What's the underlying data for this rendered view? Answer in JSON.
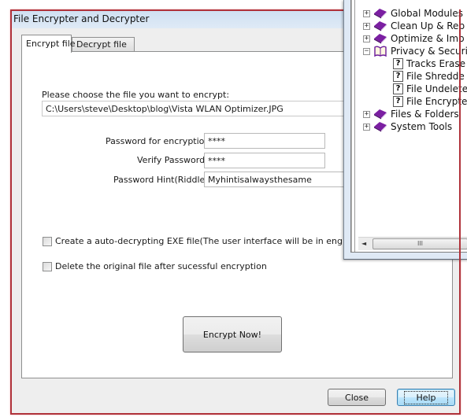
{
  "window": {
    "title": "File Encrypter and Decrypter"
  },
  "tabs": [
    {
      "label": "Encrypt file",
      "active": true
    },
    {
      "label": "Decrypt file",
      "active": false
    }
  ],
  "encrypt": {
    "choose_label": "Please choose the file you want to encrypt:",
    "file_path": "C:\\Users\\steve\\Desktop\\blog\\Vista WLAN Optimizer.JPG",
    "password_label": "Password for encryption:",
    "password_value": "****",
    "verify_label": "Verify Password:",
    "verify_value": "****",
    "hint_label": "Password Hint(Riddle):",
    "hint_value": "Myhintisalwaysthesame",
    "options": [
      {
        "label": "Create a auto-decrypting EXE file(The user interface will be in english)",
        "checked": false
      },
      {
        "label": "Delete the original file after sucessful encryption",
        "checked": false
      }
    ],
    "encrypt_button": "Encrypt Now!"
  },
  "footer": {
    "close_label": "Close",
    "help_label": "Help"
  },
  "tree": {
    "items": [
      {
        "label": "Global Modules",
        "level": 0,
        "expander": "+",
        "icon": "book-closed"
      },
      {
        "label": "Clean Up & Rep",
        "level": 0,
        "expander": "+",
        "icon": "book-closed"
      },
      {
        "label": "Optimize & Imp",
        "level": 0,
        "expander": "+",
        "icon": "book-closed"
      },
      {
        "label": "Privacy & Securi",
        "level": 0,
        "expander": "−",
        "icon": "book-open"
      },
      {
        "label": "Tracks Erase",
        "level": 1,
        "icon": "help-page"
      },
      {
        "label": "File Shredde",
        "level": 1,
        "icon": "help-page"
      },
      {
        "label": "File Undelete",
        "level": 1,
        "icon": "help-page"
      },
      {
        "label": "File Encrypte",
        "level": 1,
        "icon": "help-page"
      },
      {
        "label": "Files & Folders",
        "level": 0,
        "expander": "+",
        "icon": "book-closed"
      },
      {
        "label": "System Tools",
        "level": 0,
        "expander": "+",
        "icon": "book-closed"
      }
    ],
    "help_glyph": "?",
    "scroll_left_glyph": "◄",
    "scroll_thumb_glyph": "III"
  },
  "colors": {
    "frame_red": "#b0323a",
    "book_purple": "#7b1fa2"
  }
}
